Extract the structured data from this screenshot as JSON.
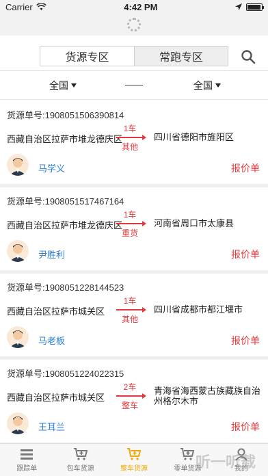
{
  "status_bar": {
    "carrier": "Carrier",
    "time": "4:42 PM"
  },
  "tabs": {
    "left": "货源专区",
    "right": "常跑专区"
  },
  "filter": {
    "from": "全国",
    "to": "全国"
  },
  "cards": [
    {
      "order": "货源单号:1908051506390814",
      "from": "西藏自治区拉萨市堆龙德庆区",
      "count": "1车",
      "type": "其他",
      "to": "四川省德阳市旌阳区",
      "name": "马学义",
      "quote": "报价单"
    },
    {
      "order": "货源单号:1908051517467164",
      "from": "西藏自治区拉萨市堆龙德庆区",
      "count": "1车",
      "type": "重货",
      "to": "河南省周口市太康县",
      "name": "尹胜利",
      "quote": "报价单"
    },
    {
      "order": "货源单号:1908051228144523",
      "from": "西藏自治区拉萨市城关区",
      "count": "1车",
      "type": "其他",
      "to": "四川省成都市都江堰市",
      "name": "马老板",
      "quote": "报价单"
    },
    {
      "order": "货源单号:1908051224022315",
      "from": "西藏自治区拉萨市城关区",
      "count": "2车",
      "type": "整车",
      "to": "青海省海西蒙古族藏族自治州格尔木市",
      "name": "王耳兰",
      "quote": "报价单"
    }
  ],
  "tabbar": [
    {
      "label": "跟踪单",
      "icon": "list-icon"
    },
    {
      "label": "包车货源",
      "icon": "cart-plus-icon"
    },
    {
      "label": "整车货源",
      "icon": "cart-plus-icon"
    },
    {
      "label": "零单货源",
      "icon": "cart-plus-icon"
    },
    {
      "label": "我的",
      "icon": "user-icon"
    }
  ],
  "watermark": "听一听载",
  "colors": {
    "accent_red": "#e0393e",
    "name_blue": "#2a7fd4",
    "active_tab": "#f0a90a"
  }
}
